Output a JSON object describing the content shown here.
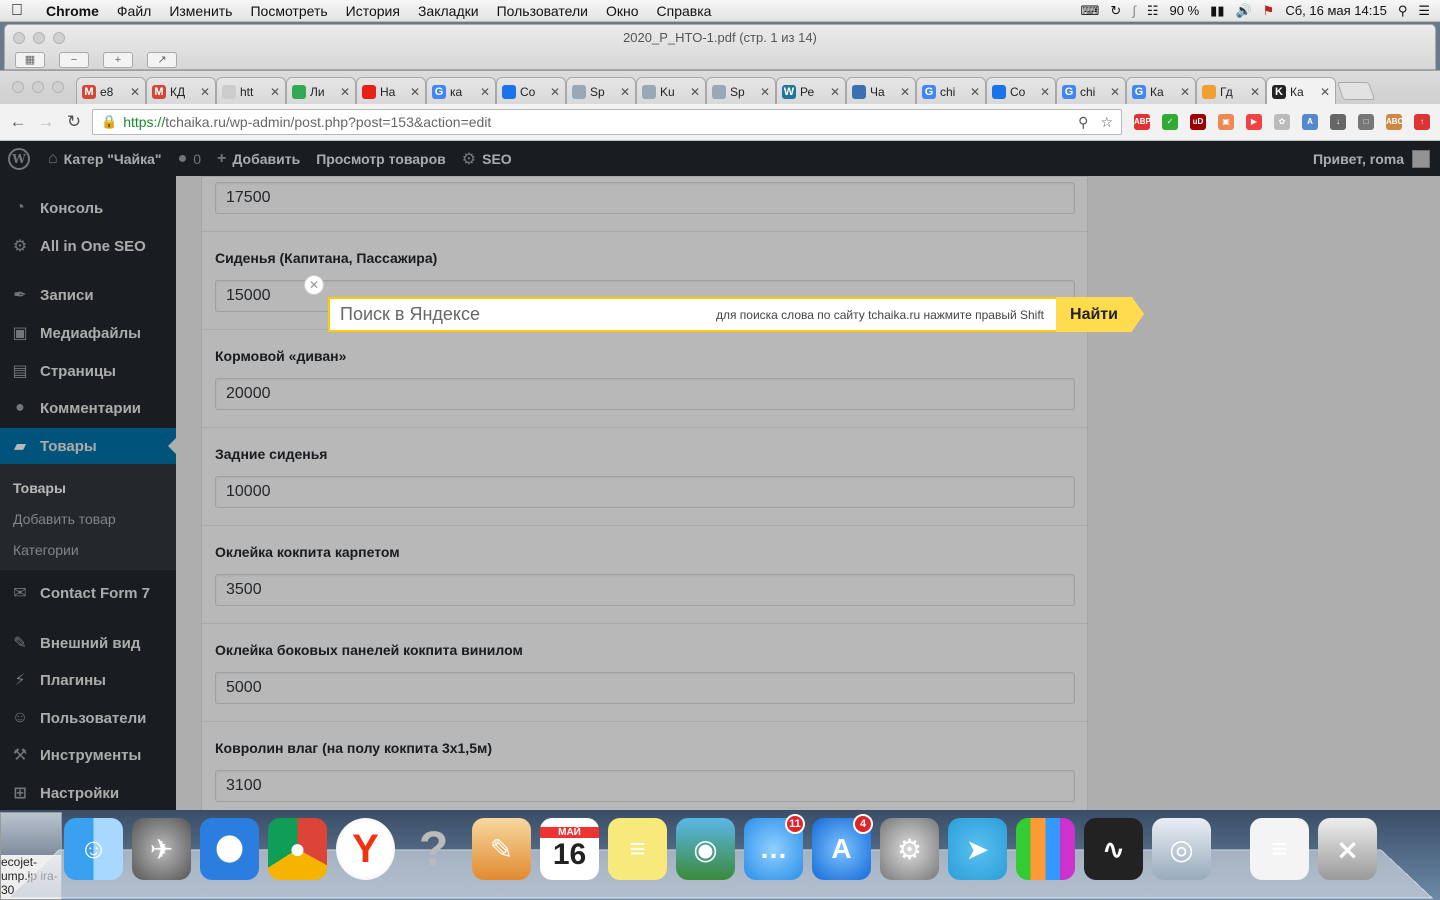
{
  "menubar": {
    "app": "Chrome",
    "items": [
      "Файл",
      "Изменить",
      "Посмотреть",
      "История",
      "Закладки",
      "Пользователи",
      "Окно",
      "Справка"
    ],
    "battery": "90 %",
    "datetime": "Сб, 16 мая  14:15"
  },
  "pdf_window": {
    "title": "2020_P_HTO-1.pdf (стр. 1 из 14)"
  },
  "tabs": [
    {
      "label": "e8",
      "fav": "M",
      "color": "#d44638"
    },
    {
      "label": "КД",
      "fav": "M",
      "color": "#d44638"
    },
    {
      "label": "htt",
      "fav": "",
      "color": "#cccccc"
    },
    {
      "label": "Ли",
      "fav": "",
      "color": "#34a853"
    },
    {
      "label": "На",
      "fav": "",
      "color": "#e62117"
    },
    {
      "label": "ка",
      "fav": "G",
      "color": "#4285f4"
    },
    {
      "label": "Co",
      "fav": "",
      "color": "#1a73e8"
    },
    {
      "label": "Sp",
      "fav": "",
      "color": "#9aa7b5"
    },
    {
      "label": "Ku",
      "fav": "",
      "color": "#9aa7b5"
    },
    {
      "label": "Sp",
      "fav": "",
      "color": "#9aa7b5"
    },
    {
      "label": "Ре",
      "fav": "W",
      "color": "#21759b"
    },
    {
      "label": "Ча",
      "fav": "",
      "color": "#3a6fb0"
    },
    {
      "label": "chi",
      "fav": "G",
      "color": "#4285f4"
    },
    {
      "label": "Co",
      "fav": "",
      "color": "#1a73e8"
    },
    {
      "label": "chi",
      "fav": "G",
      "color": "#4285f4"
    },
    {
      "label": "Ка",
      "fav": "G",
      "color": "#4285f4"
    },
    {
      "label": "Гд",
      "fav": "",
      "color": "#f0a030"
    },
    {
      "label": "Ка",
      "fav": "K",
      "color": "#222222"
    }
  ],
  "address": {
    "scheme": "https://",
    "rest": "tchaika.ru/wp-admin/post.php?post=153&action=edit"
  },
  "adminbar": {
    "site": "Катер \"Чайка\"",
    "comments": "0",
    "add": "Добавить",
    "view": "Просмотр товаров",
    "seo": "SEO",
    "howdy": "Привет, roma"
  },
  "sidebar": {
    "items": [
      {
        "label": "Консоль",
        "icon": "dashboard-icon"
      },
      {
        "label": "All in One SEO",
        "icon": "gear-icon"
      },
      {
        "label": "Записи",
        "icon": "pin-icon"
      },
      {
        "label": "Медиафайлы",
        "icon": "media-icon"
      },
      {
        "label": "Страницы",
        "icon": "pages-icon"
      },
      {
        "label": "Комментарии",
        "icon": "comment-icon"
      },
      {
        "label": "Товары",
        "icon": "boat-icon"
      },
      {
        "label": "Contact Form 7",
        "icon": "mail-icon"
      },
      {
        "label": "Внешний вид",
        "icon": "brush-icon"
      },
      {
        "label": "Плагины",
        "icon": "plugin-icon"
      },
      {
        "label": "Пользователи",
        "icon": "user-icon"
      },
      {
        "label": "Инструменты",
        "icon": "wrench-icon"
      },
      {
        "label": "Настройки",
        "icon": "settings-icon"
      }
    ],
    "submenu": [
      "Товары",
      "Добавить товар",
      "Категории"
    ]
  },
  "fields": [
    {
      "label": "",
      "value": "17500"
    },
    {
      "label": "Сиденья (Капитана, Пассажира)",
      "value": "15000"
    },
    {
      "label": "Кормовой «диван»",
      "value": "20000"
    },
    {
      "label": "Задние сиденья",
      "value": "10000"
    },
    {
      "label": "Оклейка кокпита карпетом",
      "value": "3500"
    },
    {
      "label": "Оклейка боковых панелей кокпита винилом",
      "value": "5000"
    },
    {
      "label": "Ковролин влаг (на полу кокпита 3х1,5м)",
      "value": "3100"
    }
  ],
  "yandex": {
    "placeholder": "Поиск в Яндексе",
    "hint": "для поиска слова по сайту tchaika.ru нажмите правый Shift",
    "button": "Найти",
    "color": "#ffdb4d"
  },
  "desktop": {
    "thumb_text": "ecojet-ump.jp ira-30"
  },
  "dock": {
    "badges": {
      "messages": "11",
      "appstore": "4"
    },
    "calendar": {
      "month": "МАЙ",
      "day": "16"
    },
    "icons": [
      "finder-icon",
      "launchpad-icon",
      "safari-icon",
      "chrome-icon",
      "yandex-icon",
      "help-icon",
      "pages-icon",
      "calendar-icon",
      "stickies-icon",
      "photo-icon",
      "messages-icon",
      "appstore-icon",
      "preferences-icon",
      "telegram-icon",
      "numbers-icon",
      "activity-icon",
      "preview-icon",
      "document-icon",
      "trash-icon"
    ]
  }
}
